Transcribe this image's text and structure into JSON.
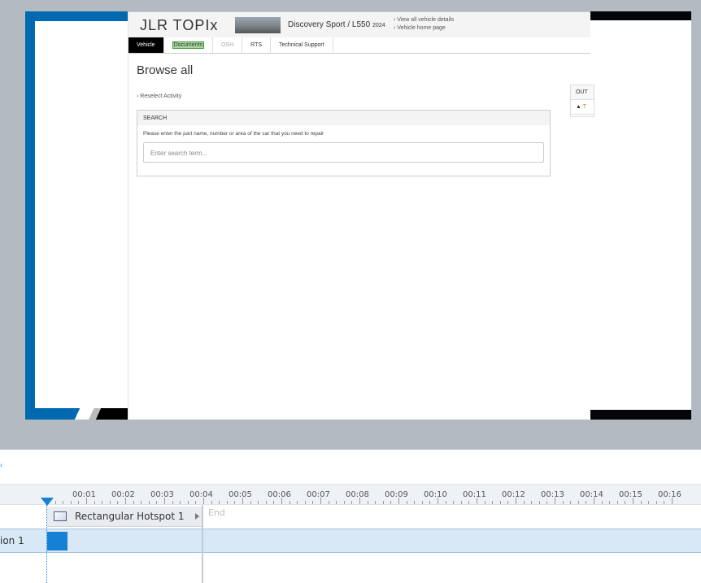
{
  "app": {
    "logo": "JLR TOPIx",
    "vehicle": "Discovery Sport / L550",
    "year": "2024",
    "links": [
      "› View all vehicle details",
      "› Vehicle home page"
    ],
    "tabs": [
      "Vehicle",
      "Documents",
      "OSH",
      "RTS",
      "Technical Support"
    ],
    "title": "Browse all",
    "reselect": "› Reselect Activity",
    "search": {
      "header": "SEARCH",
      "prompt": "Please enter the part name, number or area of the car that you need to repair",
      "placeholder": "Enter search term..."
    },
    "side": {
      "header": "OUT",
      "warning": "T"
    }
  },
  "timeline": {
    "ticks": [
      "00:01",
      "00:02",
      "00:03",
      "00:04",
      "00:05",
      "00:06",
      "00:07",
      "00:08",
      "00:09",
      "00:10",
      "00:11",
      "00:12",
      "00:13",
      "00:14",
      "00:15",
      "00:16"
    ],
    "hotspot": "Rectangular Hotspot 1",
    "end": "End",
    "row_label": "ion 1"
  }
}
